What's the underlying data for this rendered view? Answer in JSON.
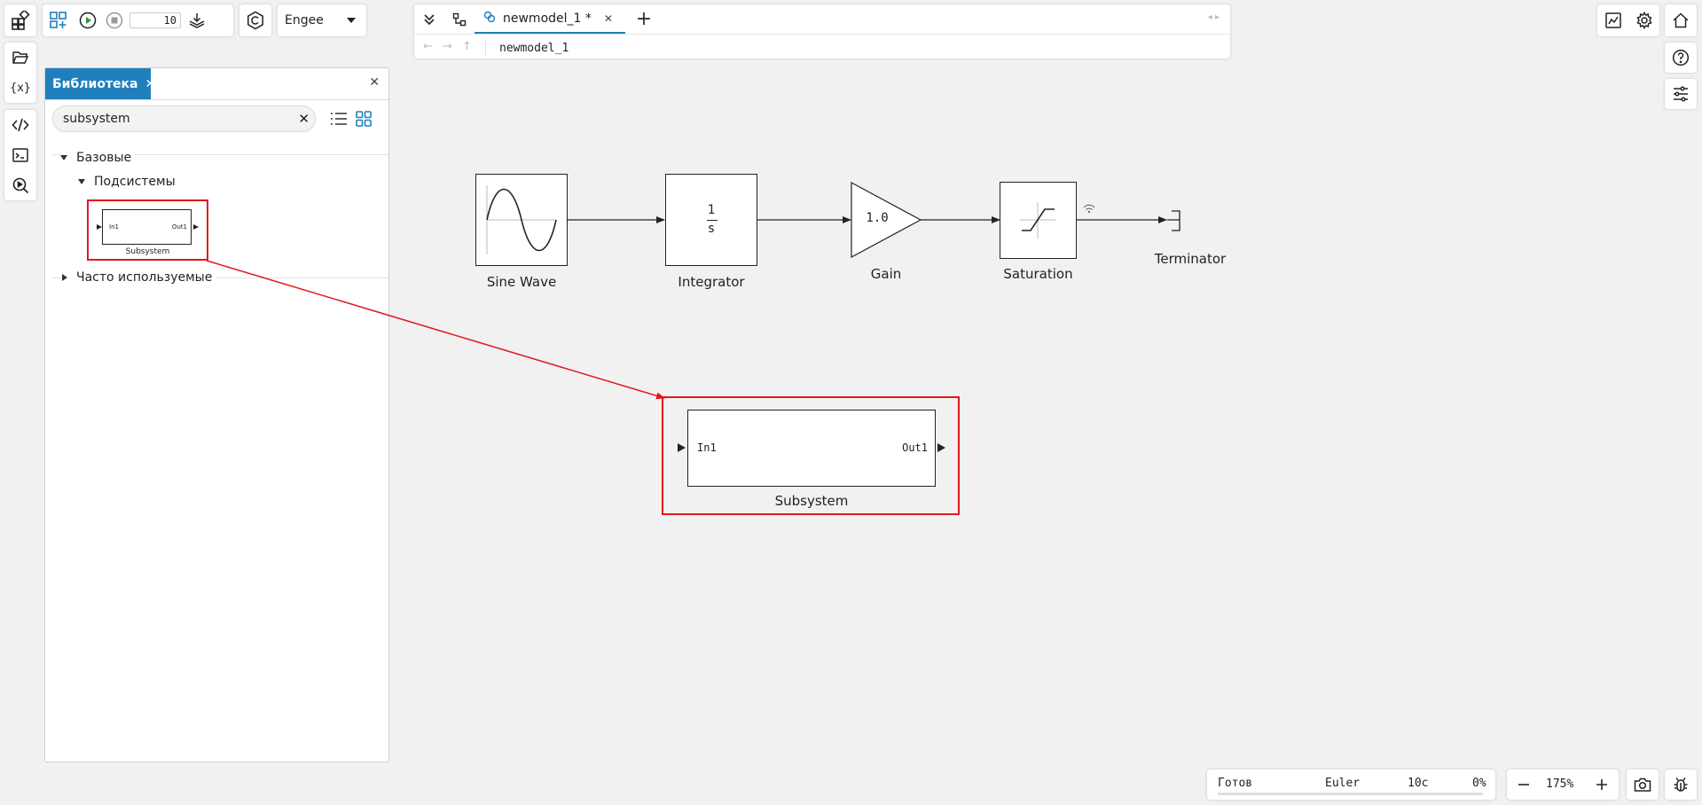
{
  "toolbar": {
    "sim_time_value": "10",
    "solver_dropdown": "Engee"
  },
  "tabs": {
    "active_tab_label": "newmodel_1 *",
    "breadcrumb": "newmodel_1"
  },
  "library": {
    "tab_label": "Библиотека",
    "search_value": "subsystem",
    "tree": {
      "basic": "Базовые",
      "subsystems": "Подсистемы",
      "frequent": "Часто используемые"
    },
    "subsystem_block": {
      "in_port": "In1",
      "out_port": "Out1",
      "name": "Subsystem"
    }
  },
  "canvas": {
    "blocks": {
      "sine_wave": "Sine Wave",
      "integrator": "Integrator",
      "integrator_num": "1",
      "integrator_den": "s",
      "gain": "Gain",
      "gain_value": "1.0",
      "saturation": "Saturation",
      "terminator": "Terminator"
    },
    "subsystem": {
      "in_port": "In1",
      "out_port": "Out1",
      "name": "Subsystem"
    }
  },
  "status": {
    "state": "Готов",
    "solver": "Euler",
    "time": "10с",
    "progress": "0%",
    "progress_fraction": 0,
    "zoom": "175%"
  },
  "colors": {
    "accent": "#1f7fbd",
    "highlight": "#e0191e",
    "run_green": "#2e9a3c"
  }
}
